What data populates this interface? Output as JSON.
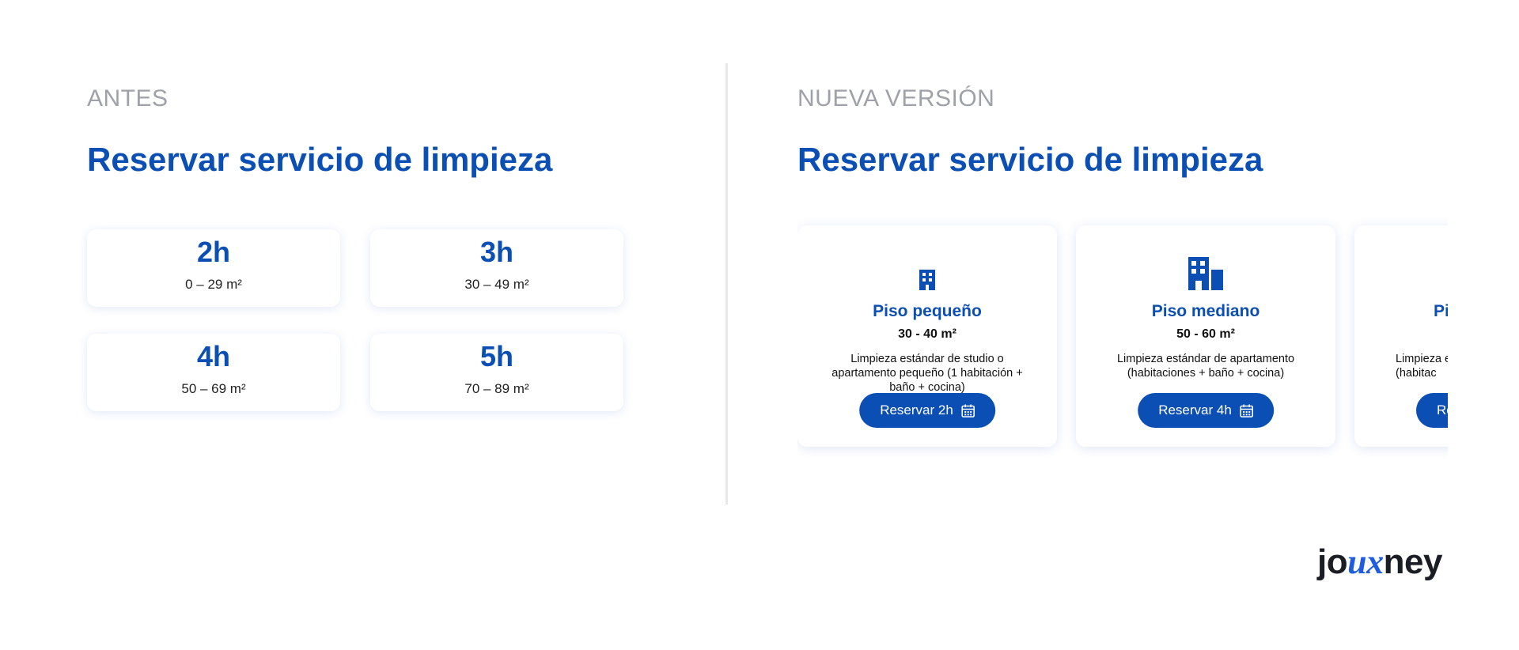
{
  "left": {
    "label": "ANTES",
    "title": "Reservar servicio de limpieza",
    "cards": [
      {
        "hours": "2h",
        "area": "0 – 29 m²"
      },
      {
        "hours": "3h",
        "area": "30 – 49 m²"
      },
      {
        "hours": "4h",
        "area": "50 – 69 m²"
      },
      {
        "hours": "5h",
        "area": "70 – 89 m²"
      }
    ]
  },
  "right": {
    "label": "NUEVA VERSIÓN",
    "title": "Reservar servicio de limpieza",
    "cards": [
      {
        "icon": "small-building-icon",
        "title": "Piso pequeño",
        "area": "30 - 40 m²",
        "description": "Limpieza estándar de studio o apartamento pequeño (1 habitación + baño + cocina)",
        "button": "Reservar 2h"
      },
      {
        "icon": "medium-building-icon",
        "title": "Piso mediano",
        "area": "50 - 60 m²",
        "description": "Limpieza estándar de apartamento (habitaciones + baño + cocina)",
        "button": "Reservar 4h"
      },
      {
        "icon": "large-building-icon",
        "title": "Pi",
        "area": "",
        "description": "Limpieza e (habitac",
        "button": "Re"
      }
    ]
  },
  "logo": {
    "prefix": "jo",
    "highlight": "ux",
    "suffix": "ney"
  },
  "colors": {
    "accent": "#0b4fb5",
    "label": "#9ea2a8",
    "divider": "#e6e8ec"
  }
}
